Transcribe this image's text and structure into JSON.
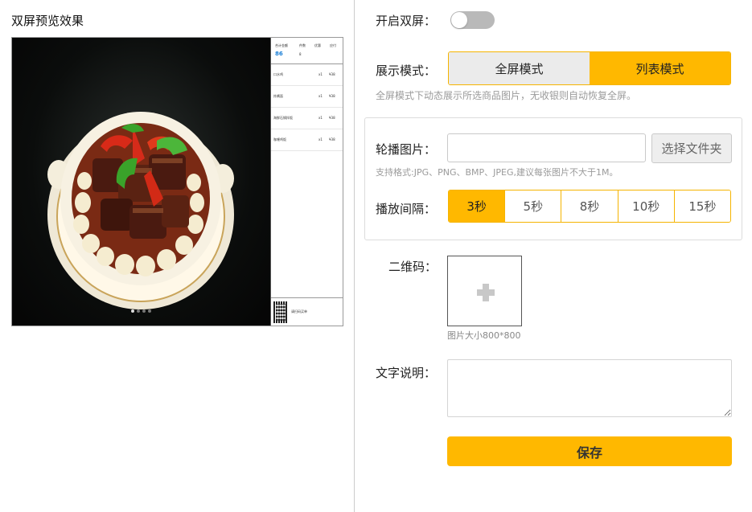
{
  "preview": {
    "title": "双屏预览效果",
    "side": {
      "total_label": "合计金额",
      "total_value": "86",
      "qty_label": "件数",
      "qty_value": "8",
      "discount_label": "优惠",
      "pay_label": "应付",
      "items": [
        {
          "name": "口水鸡",
          "qty": "x1",
          "price": "¥38"
        },
        {
          "name": "炸酱面",
          "qty": "x1",
          "price": "¥38"
        },
        {
          "name": "海鲜石锅拌饭",
          "qty": "x1",
          "price": "¥38"
        },
        {
          "name": "咖喱鸡饭",
          "qty": "x1",
          "price": "¥38"
        }
      ],
      "footer_text": "请扫码买单"
    }
  },
  "settings": {
    "dual_screen": {
      "label": "开启双屏：",
      "enabled": false
    },
    "display_mode": {
      "label": "展示模式：",
      "options": [
        "全屏模式",
        "列表模式"
      ],
      "selected": "列表模式",
      "hint": "全屏模式下动态展示所选商品图片，无收银则自动恢复全屏。"
    },
    "carousel": {
      "label": "轮播图片：",
      "value": "",
      "folder_button": "选择文件夹",
      "hint": "支持格式:JPG、PNG、BMP、JPEG,建议每张图片不大于1M。"
    },
    "interval": {
      "label": "播放间隔：",
      "options": [
        "3秒",
        "5秒",
        "8秒",
        "10秒",
        "15秒"
      ],
      "selected": "3秒"
    },
    "qr_code": {
      "label": "二维码：",
      "size_hint": "图片大小800*800"
    },
    "description": {
      "label": "文字说明：",
      "value": ""
    },
    "save_button": "保存"
  },
  "colors": {
    "accent": "#ffb800",
    "border_accent": "#f5b400",
    "toggle_off": "#b9b9b9",
    "hint_text": "#9a9a9a"
  }
}
